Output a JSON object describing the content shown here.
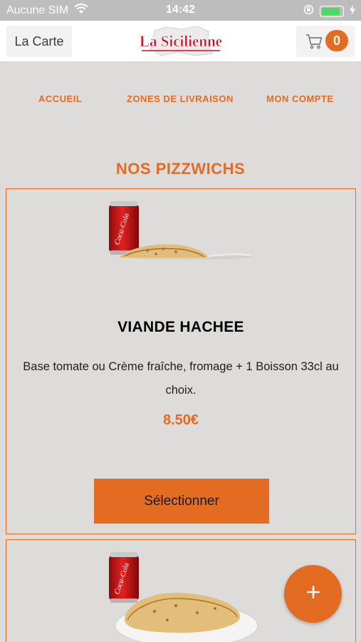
{
  "status_bar": {
    "carrier": "Aucune SIM",
    "time": "14:42",
    "wifi_icon": "wifi-icon",
    "battery_level": 0.9
  },
  "header": {
    "menu_label": "La Carte",
    "logo_text": "La Sicilienne",
    "cart_count": "0",
    "cart_icon": "cart-icon"
  },
  "nav": {
    "items": [
      "ACCUEIL",
      "ZONES DE LIVRAISON",
      "MON COMPTE"
    ]
  },
  "section": {
    "title": "NOS PIZZWICHS"
  },
  "products": [
    {
      "name": "VIANDE HACHEE",
      "description": "Base tomate ou Crème fraîche, fromage  + 1 Boisson 33cl au choix.",
      "price": "8.50€",
      "button_label": "Sélectionner",
      "can_label": "Coca-Cola"
    },
    {
      "can_label": "Coca-Cola"
    }
  ],
  "fab": {
    "icon": "plus-icon"
  },
  "colors": {
    "accent": "#e46b22",
    "background": "#dedcdb",
    "logo_red": "#c8102e"
  }
}
